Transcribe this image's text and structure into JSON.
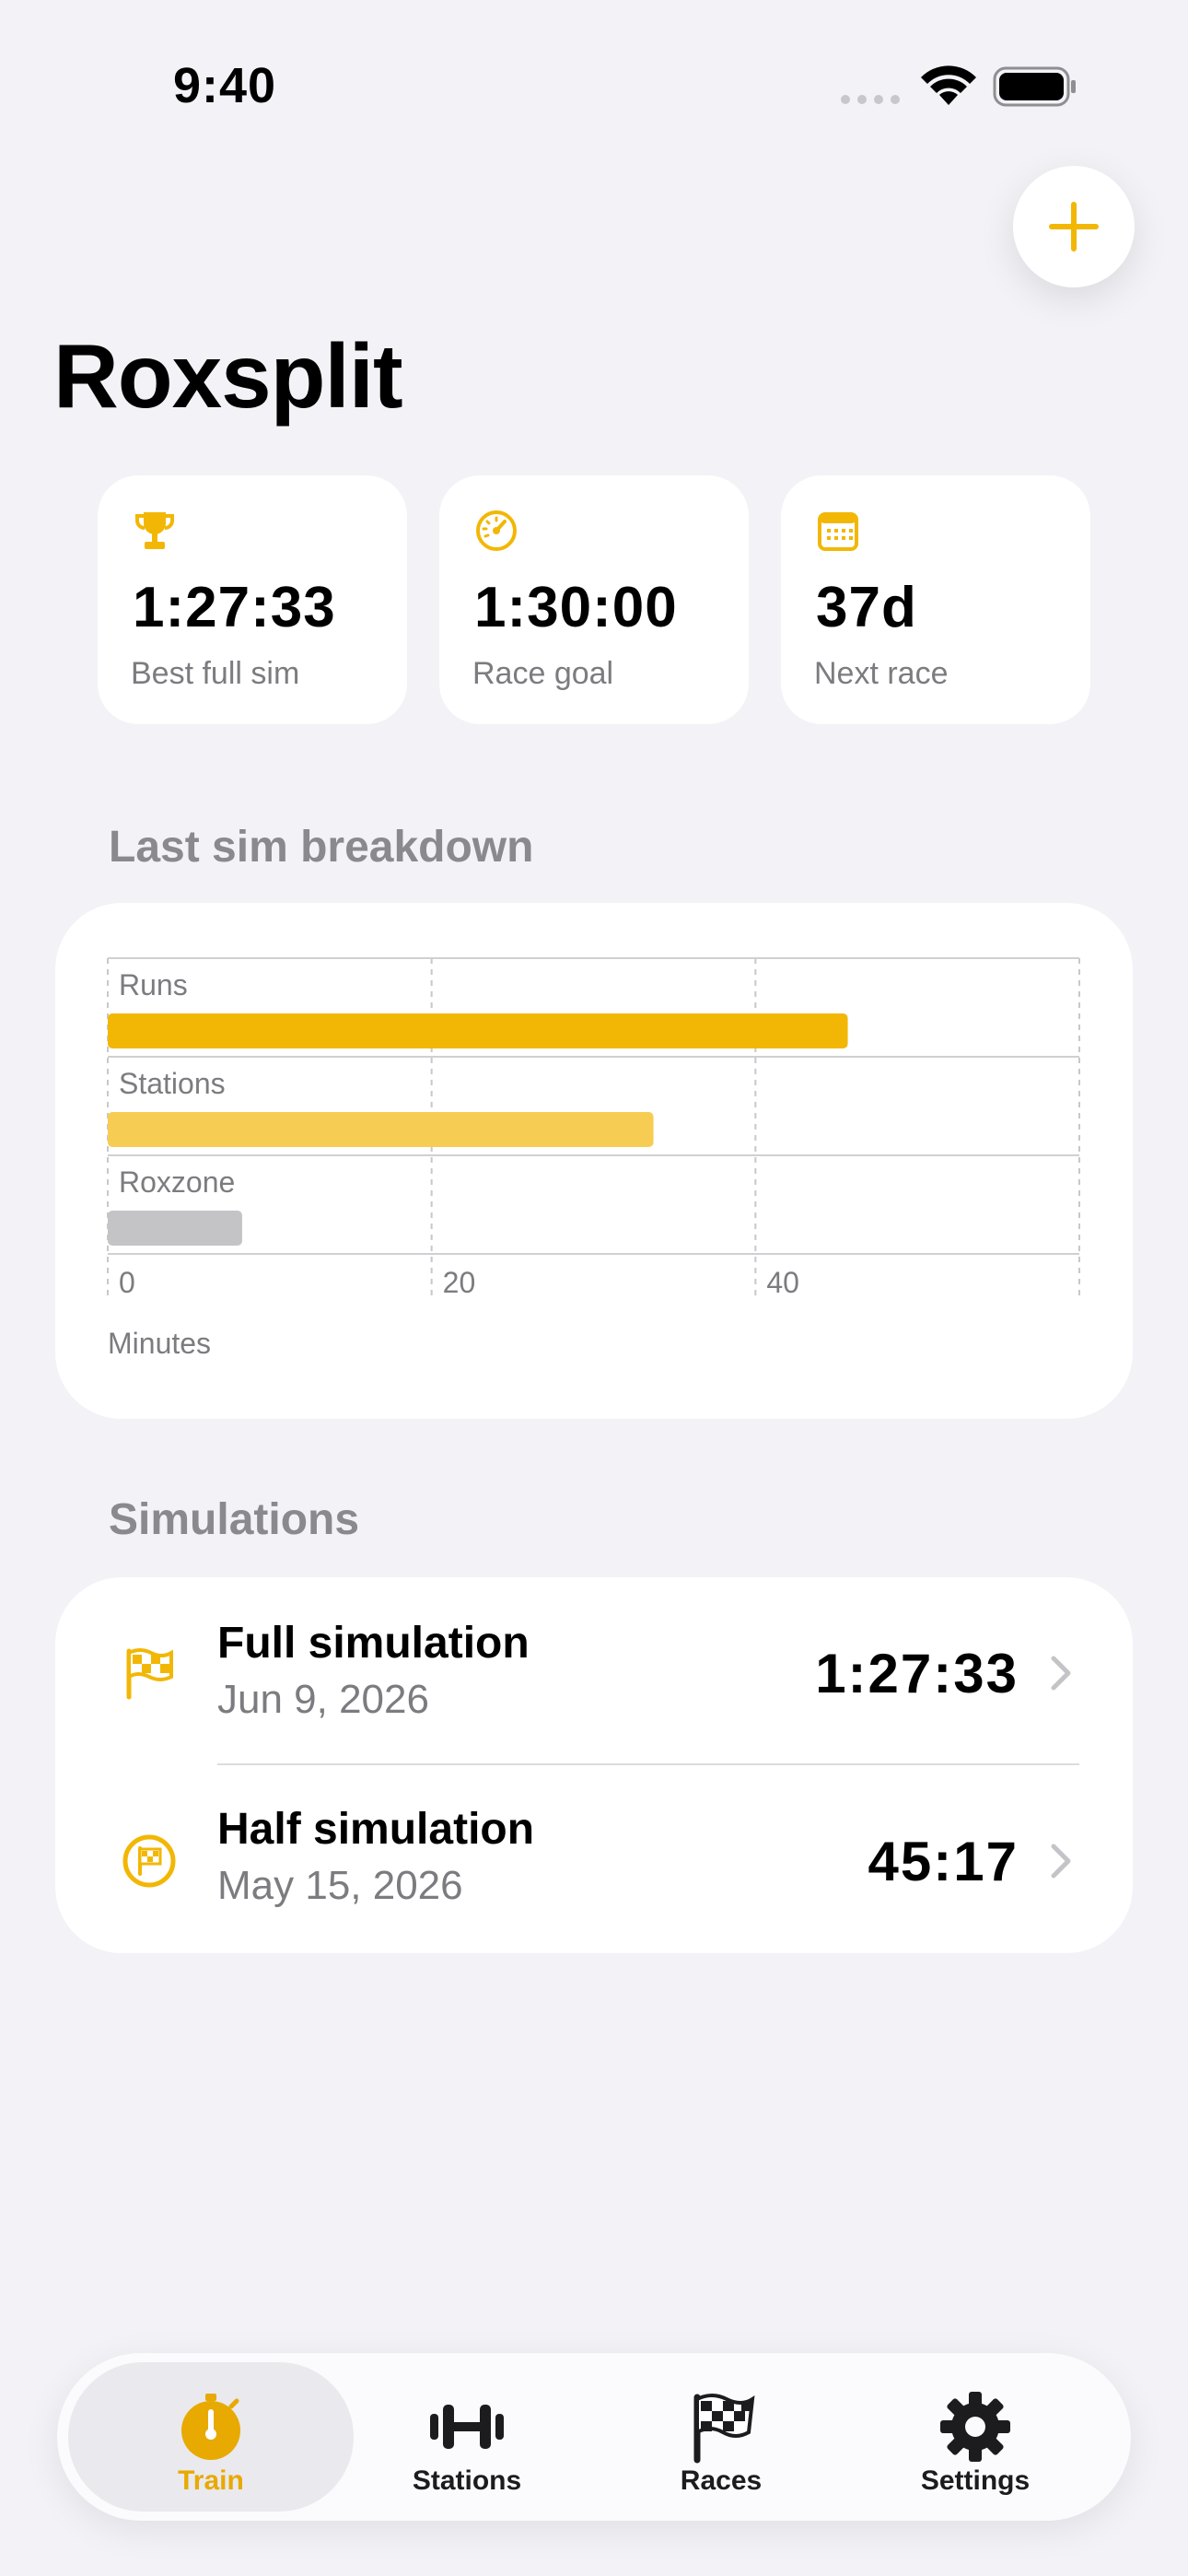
{
  "status_bar": {
    "time": "9:40"
  },
  "app": {
    "title": "Roxsplit",
    "accent_color": "#F2B705"
  },
  "stats": [
    {
      "icon": "trophy-icon",
      "value": "1:27:33",
      "label": "Best full sim"
    },
    {
      "icon": "speedometer-icon",
      "value": "1:30:00",
      "label": "Race goal"
    },
    {
      "icon": "calendar-icon",
      "value": "37d",
      "label": "Next race"
    }
  ],
  "breakdown": {
    "header": "Last sim breakdown",
    "chart_data": {
      "type": "bar",
      "orientation": "horizontal",
      "categories": [
        "Runs",
        "Stations",
        "Roxzone"
      ],
      "values": [
        45.7,
        33.7,
        8.3
      ],
      "colors": [
        "#F2B705",
        "#F7CC52",
        "#C4C4C6"
      ],
      "xlabel": "Minutes",
      "xticks": [
        0,
        20,
        40
      ],
      "xlim": [
        0,
        60
      ],
      "grid": true
    }
  },
  "simulations": {
    "header": "Simulations",
    "items": [
      {
        "icon": "checkered-flag-icon",
        "title": "Full simulation",
        "date": "Jun 9, 2026",
        "time": "1:27:33"
      },
      {
        "icon": "flag-circle-icon",
        "title": "Half simulation",
        "date": "May 15, 2026",
        "time": "45:17"
      }
    ]
  },
  "tabs": [
    {
      "icon": "stopwatch-icon",
      "label": "Train",
      "active": true
    },
    {
      "icon": "dumbbell-icon",
      "label": "Stations",
      "active": false
    },
    {
      "icon": "race-flag-icon",
      "label": "Races",
      "active": false
    },
    {
      "icon": "gear-icon",
      "label": "Settings",
      "active": false
    }
  ]
}
